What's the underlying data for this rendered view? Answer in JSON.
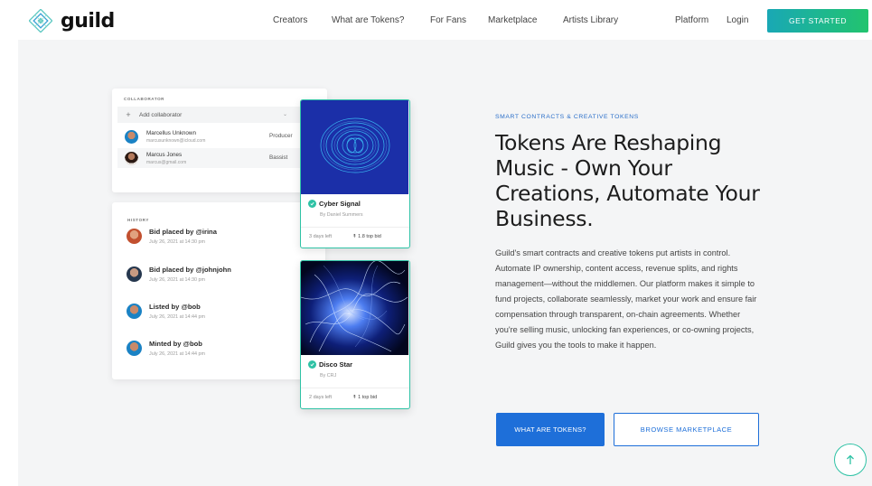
{
  "nav": {
    "logo_text": "guild",
    "links": [
      "Creators",
      "What are Tokens?",
      "For Fans",
      "Marketplace",
      "Artists Library",
      "Platform",
      "Login"
    ],
    "cta_label": "GET STARTED"
  },
  "collaborator_card": {
    "heading": "COLLABORATOR",
    "add_label": "Add collaborator",
    "people": [
      {
        "name": "Marcellus Unknown",
        "email": "marcusunknown@icloud.com",
        "role": "Producer"
      },
      {
        "name": "Marcus Jones",
        "email": "marcus@gmail.com",
        "role": "Bassist"
      }
    ]
  },
  "history_card": {
    "heading": "HISTORY",
    "items": [
      {
        "title": "Bid placed by @irina",
        "date": "July 26, 2021 at 14:30 pm"
      },
      {
        "title": "Bid placed by @johnjohn",
        "date": "July 26, 2021 at 14:30 pm"
      },
      {
        "title": "Listed by @bob",
        "date": "July 26, 2021 at 14:44 pm"
      },
      {
        "title": "Minted by @bob",
        "date": "July 26, 2021 at 14:44 pm"
      }
    ]
  },
  "tokens": [
    {
      "title": "Cyber Signal",
      "by": "By Daniel Summers",
      "time_left": "3 days left",
      "bid": "1.8 top bid"
    },
    {
      "title": "Disco Star",
      "by": "By CRJ",
      "time_left": "2 days left",
      "bid": "1 top bid"
    }
  ],
  "hero": {
    "eyebrow": "SMART CONTRACTS & CREATIVE TOKENS",
    "headline": "Tokens Are Reshaping Music - Own Your Creations, Automate Your Business.",
    "body": "Guild's smart contracts and creative tokens put artists in control. Automate IP ownership, content access, revenue splits, and rights management—without the middlemen. Our platform makes it simple to fund projects, collaborate seamlessly, market your work and ensure fair compensation through transparent, on-chain agreements. Whether you're selling music, unlocking fan experiences, or co-owning projects, Guild gives you the tools to make it happen.",
    "primary_button": "WHAT ARE TOKENS?",
    "secondary_button": "BROWSE MARKETPLACE"
  },
  "colors": {
    "accent_blue": "#1e6fd9",
    "accent_teal": "#2ec2a5",
    "cta_gradient_start": "#19a8b5",
    "cta_gradient_end": "#22c46e"
  },
  "icons": {
    "logo": "guild-diamond-logo",
    "scroll_top": "arrow-up-icon",
    "verified": "check-icon",
    "bid": "bid-arrow-icon"
  }
}
